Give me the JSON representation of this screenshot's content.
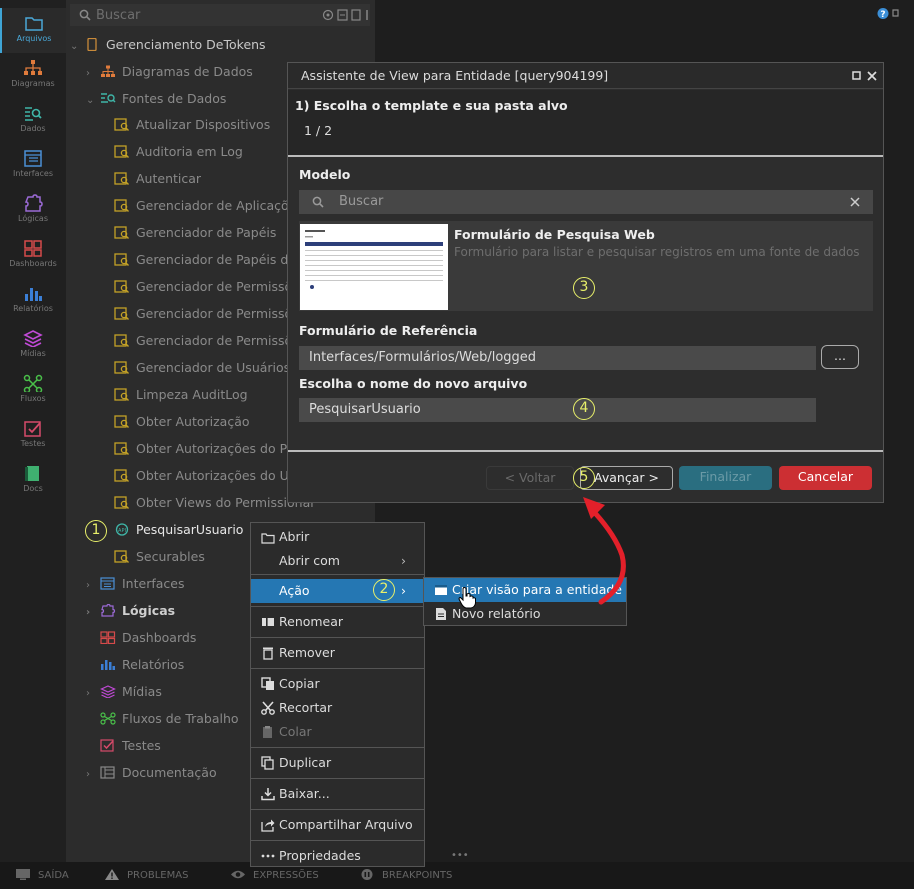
{
  "activity_bar": [
    {
      "label": "Arquivos",
      "icon": "folder-icon",
      "active": true
    },
    {
      "label": "Diagramas",
      "icon": "diagram-icon",
      "color": "#e07b3c"
    },
    {
      "label": "Dados",
      "icon": "data-icon",
      "color": "#3fb6a8"
    },
    {
      "label": "Interfaces",
      "icon": "interface-icon",
      "color": "#4a8fd6"
    },
    {
      "label": "Lógicas",
      "icon": "logic-icon",
      "color": "#9b6ad6"
    },
    {
      "label": "Dashboards",
      "icon": "dashboard-icon",
      "color": "#d64a4a"
    },
    {
      "label": "Relatórios",
      "icon": "report-icon",
      "color": "#3b7fd6"
    },
    {
      "label": "Mídias",
      "icon": "media-icon",
      "color": "#c04ad6"
    },
    {
      "label": "Fluxos",
      "icon": "flow-icon",
      "color": "#4ac04a"
    },
    {
      "label": "Testes",
      "icon": "test-icon",
      "color": "#d64a6a"
    },
    {
      "label": "Docs",
      "icon": "docs-icon",
      "color": "#3fb070"
    }
  ],
  "panel": {
    "search_placeholder": "Buscar",
    "project": "Gerenciamento DeTokens",
    "folders": {
      "diagramas": "Diagramas de Dados",
      "fontes": "Fontes de Dados"
    },
    "datasources": [
      "Atualizar Dispositivos",
      "Auditoria em Log",
      "Autenticar",
      "Gerenciador de Aplicações d",
      "Gerenciador de Papéis",
      "Gerenciador de Papéis de U",
      "Gerenciador de Permissões",
      "Gerenciador de Permissões",
      "Gerenciador de Permissões",
      "Gerenciador de Usuários",
      "Limpeza AuditLog",
      "Obter Autorização",
      "Obter Autorizações do Papel",
      "Obter Autorizações do Usuá",
      "Obter Views do Permissionar"
    ],
    "selected_item": "PesquisarUsuario",
    "after_selected": "Securables",
    "sections": [
      {
        "label": "Interfaces",
        "bold": false,
        "arrow": true
      },
      {
        "label": "Lógicas",
        "bold": true,
        "arrow": true
      },
      {
        "label": "Dashboards",
        "bold": false,
        "arrow": false
      },
      {
        "label": "Relatórios",
        "bold": false,
        "arrow": false
      },
      {
        "label": "Mídias",
        "bold": false,
        "arrow": true
      },
      {
        "label": "Fluxos de Trabalho",
        "bold": false,
        "arrow": false
      },
      {
        "label": "Testes",
        "bold": false,
        "arrow": false
      },
      {
        "label": "Documentação",
        "bold": false,
        "arrow": true
      }
    ]
  },
  "status_bar": [
    {
      "label": "SAÍDA",
      "icon": "monitor-icon"
    },
    {
      "label": "PROBLEMAS",
      "icon": "warning-icon"
    },
    {
      "label": "EXPRESSÕES",
      "icon": "eye-icon"
    },
    {
      "label": "BREAKPOINTS",
      "icon": "pause-icon"
    }
  ],
  "dialog": {
    "title": "Assistente de View para Entidade [query904199]",
    "step_title": "1) Escolha o template e sua pasta alvo",
    "step_counter": "1 / 2",
    "model_label": "Modelo",
    "search_placeholder": "Buscar",
    "template_name": "Formulário de Pesquisa Web",
    "template_desc": "Formulário para listar e pesquisar registros em uma fonte de dados",
    "ref_label": "Formulário de Referência",
    "ref_value": "Interfaces/Formulários/Web/logged",
    "browse_label": "...",
    "filename_label": "Escolha o nome do novo arquivo",
    "filename_value": "PesquisarUsuario",
    "back_label": "< Voltar",
    "next_label": "Avançar >",
    "finish_label": "Finalizar",
    "cancel_label": "Cancelar"
  },
  "context_menu": {
    "open": "Abrir",
    "open_with": "Abrir com",
    "action": "Ação",
    "rename": "Renomear",
    "remove": "Remover",
    "copy": "Copiar",
    "cut": "Recortar",
    "paste": "Colar",
    "duplicate": "Duplicar",
    "download": "Baixar...",
    "share": "Compartilhar Arquivo",
    "properties": "Propriedades"
  },
  "submenu": {
    "create_view": "Criar visão para a entidade",
    "new_report": "Novo relatório"
  },
  "annotations": [
    "1",
    "2",
    "3",
    "4",
    "5"
  ]
}
